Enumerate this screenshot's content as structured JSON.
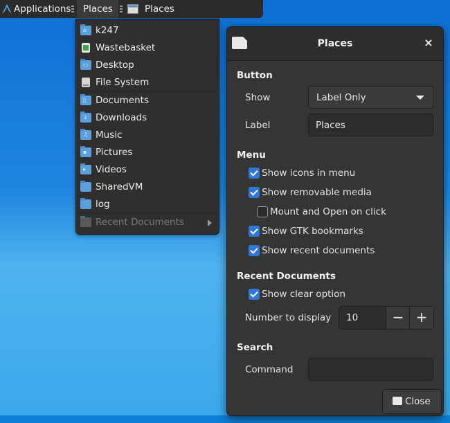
{
  "panel": {
    "applications_label": "Applications",
    "places_label": "Places",
    "window_button_label": "Places"
  },
  "menu": {
    "items": [
      {
        "label": "k247",
        "icon": "home-folder-icon"
      },
      {
        "label": "Wastebasket",
        "icon": "trash-icon"
      },
      {
        "label": "Desktop",
        "icon": "desktop-folder-icon"
      },
      {
        "label": "File System",
        "icon": "drive-icon"
      },
      {
        "label": "Documents",
        "icon": "documents-folder-icon"
      },
      {
        "label": "Downloads",
        "icon": "downloads-folder-icon"
      },
      {
        "label": "Music",
        "icon": "music-folder-icon"
      },
      {
        "label": "Pictures",
        "icon": "pictures-folder-icon"
      },
      {
        "label": "Videos",
        "icon": "videos-folder-icon"
      },
      {
        "label": "SharedVM",
        "icon": "folder-icon"
      },
      {
        "label": "log",
        "icon": "folder-icon"
      }
    ],
    "recent_documents_label": "Recent Documents"
  },
  "dialog": {
    "title": "Places",
    "button_section": "Button",
    "show_label": "Show",
    "show_value": "Label Only",
    "label_label": "Label",
    "label_value": "Places",
    "menu_section": "Menu",
    "show_icons": "Show icons in menu",
    "show_removable": "Show removable media",
    "mount_open": "Mount and Open on click",
    "show_gtk": "Show GTK bookmarks",
    "show_recent": "Show recent documents",
    "recent_section": "Recent Documents",
    "show_clear": "Show clear option",
    "number_label": "Number to display",
    "number_value": "10",
    "search_section": "Search",
    "command_label": "Command",
    "command_value": "",
    "close_label": "Close",
    "minus": "−",
    "plus": "+",
    "close_x": "×"
  },
  "colors": {
    "accent": "#2f78d8",
    "panel": "#2b2b2b",
    "dialog": "#353535"
  }
}
